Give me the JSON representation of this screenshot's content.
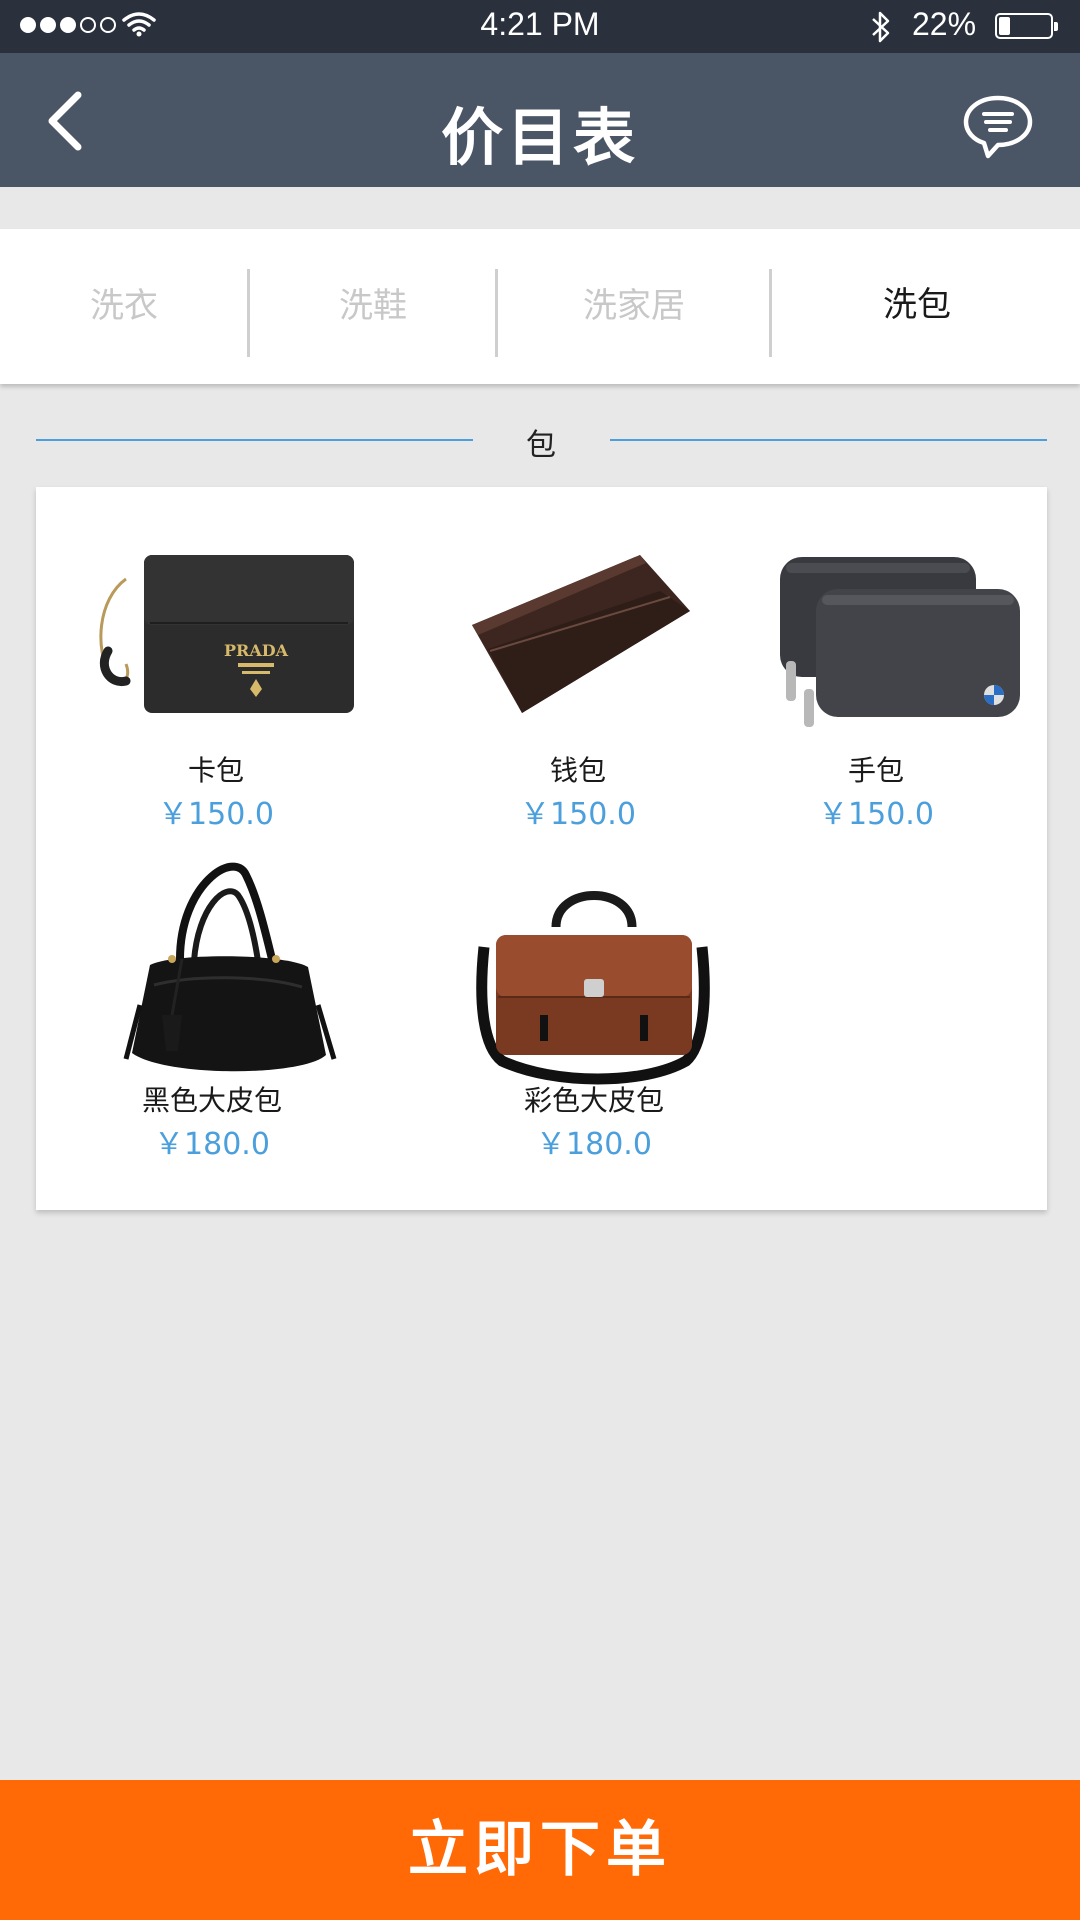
{
  "status_bar": {
    "time": "4:21 PM",
    "battery_percent": "22%",
    "signal_filled": 3,
    "signal_total": 5,
    "battery_level": 0.22
  },
  "header": {
    "title": "价目表",
    "back_icon": "chevron-left-icon",
    "message_icon": "chat-bubble-icon"
  },
  "tabs": [
    {
      "label": "洗衣",
      "active": false
    },
    {
      "label": "洗鞋",
      "active": false
    },
    {
      "label": "洗家居",
      "active": false
    },
    {
      "label": "洗包",
      "active": true
    }
  ],
  "section": {
    "title": "包"
  },
  "items": [
    {
      "name": "卡包",
      "price": "￥150.0",
      "image": "card-wallet-image"
    },
    {
      "name": "钱包",
      "price": "￥150.0",
      "image": "wallet-image"
    },
    {
      "name": "手包",
      "price": "￥150.0",
      "image": "clutch-image"
    },
    {
      "name": "黑色大皮包",
      "price": "￥180.0",
      "image": "black-handbag-image"
    },
    {
      "name": "彩色大皮包",
      "price": "￥180.0",
      "image": "brown-messenger-bag-image"
    }
  ],
  "order_button": {
    "label": "立即下单"
  },
  "colors": {
    "accent_blue": "#4a9fdc",
    "order_orange": "#ff6a06",
    "nav_bg": "#4a5566",
    "status_bg": "#2a313d"
  },
  "brand_marks": {
    "card_wallet_logo": "PRADA"
  }
}
